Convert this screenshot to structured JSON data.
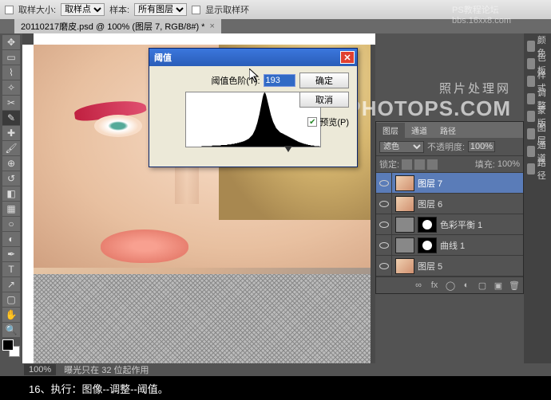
{
  "topbar": {
    "tolerance_label": "取样大小:",
    "tolerance_value": "取样点",
    "sample_label": "样本:",
    "sample_value": "所有图层",
    "show_ring_label": "显示取样环"
  },
  "document": {
    "tab_title": "20110217磨皮.psd @ 100% (图层 7, RGB/8#) *"
  },
  "watermark": {
    "top": "PS教程论坛",
    "url": "bbs.16xx8.com",
    "cn": "照片处理网",
    "en": "PHOTOPS.COM"
  },
  "dialog": {
    "title": "阈值",
    "level_label": "阈值色阶(T):",
    "level_value": "193",
    "ok": "确定",
    "cancel": "取消",
    "preview": "预览(P)"
  },
  "layers_panel": {
    "tabs": [
      "图层",
      "通道",
      "路径"
    ],
    "blend_mode": "滤色",
    "opacity_label": "不透明度:",
    "opacity_value": "100%",
    "lock_label": "锁定:",
    "fill_label": "填充:",
    "fill_value": "100%",
    "layers": [
      {
        "name": "图层 7",
        "selected": true,
        "thumb": "face"
      },
      {
        "name": "图层 6",
        "thumb": "face"
      },
      {
        "name": "色彩平衡 1",
        "thumb": "adj",
        "mask": true
      },
      {
        "name": "曲线 1",
        "thumb": "adj",
        "mask": true
      },
      {
        "name": "图层 5",
        "thumb": "face"
      }
    ]
  },
  "dock": {
    "items": [
      "颜色",
      "色板",
      "样式",
      "调整",
      "蒙版",
      "图层",
      "通道",
      "路径"
    ]
  },
  "status": {
    "zoom": "100%",
    "info": "曝光只在 32 位起作用"
  },
  "caption": "16、执行：图像--调整--阈值。",
  "chart_data": {
    "type": "area",
    "title": "阈值",
    "xlabel": "",
    "ylabel": "",
    "x_range": [
      0,
      255
    ],
    "threshold": 193,
    "values": [
      0,
      0,
      0,
      0,
      0,
      0,
      0,
      0,
      0,
      0,
      0,
      0,
      0,
      0,
      0,
      0,
      0,
      0,
      0,
      0,
      0,
      0,
      0,
      0,
      0,
      0,
      0,
      0,
      0,
      0,
      1,
      1,
      1,
      1,
      1,
      1,
      1,
      1,
      1,
      1,
      1,
      1,
      1,
      1,
      1,
      1,
      1,
      1,
      1,
      1,
      2,
      2,
      2,
      2,
      2,
      2,
      2,
      2,
      2,
      2,
      2,
      2,
      2,
      2,
      2,
      2,
      2,
      3,
      3,
      3,
      3,
      3,
      3,
      3,
      3,
      3,
      3,
      3,
      3,
      4,
      4,
      4,
      4,
      4,
      4,
      4,
      4,
      5,
      5,
      5,
      5,
      5,
      5,
      6,
      6,
      6,
      6,
      6,
      7,
      7,
      7,
      7,
      8,
      8,
      8,
      8,
      9,
      9,
      9,
      10,
      10,
      10,
      11,
      11,
      12,
      12,
      13,
      13,
      14,
      14,
      15,
      16,
      17,
      18,
      19,
      20,
      21,
      22,
      24,
      26,
      28,
      30,
      32,
      35,
      38,
      41,
      44,
      48,
      52,
      56,
      60,
      65,
      70,
      75,
      80,
      85,
      90,
      94,
      97,
      99,
      100,
      99,
      97,
      94,
      90,
      86,
      82,
      78,
      74,
      70,
      66,
      62,
      58,
      55,
      52,
      49,
      46,
      44,
      42,
      40,
      38,
      36,
      34,
      33,
      32,
      31,
      30,
      29,
      28,
      27,
      26,
      26,
      25,
      25,
      24,
      24,
      23,
      23,
      22,
      22,
      21,
      21,
      20,
      20,
      19,
      19,
      18,
      18,
      17,
      17,
      16,
      16,
      15,
      15,
      14,
      14,
      13,
      13,
      12,
      12,
      11,
      11,
      10,
      10,
      9,
      9,
      8,
      8,
      8,
      7,
      7,
      7,
      6,
      6,
      6,
      5,
      5,
      5,
      5,
      4,
      4,
      4,
      4,
      3,
      3,
      3,
      3,
      3,
      2,
      2,
      2,
      2,
      2,
      2,
      2,
      1,
      1,
      1,
      1,
      1,
      1,
      1,
      1,
      1,
      1,
      1
    ]
  }
}
